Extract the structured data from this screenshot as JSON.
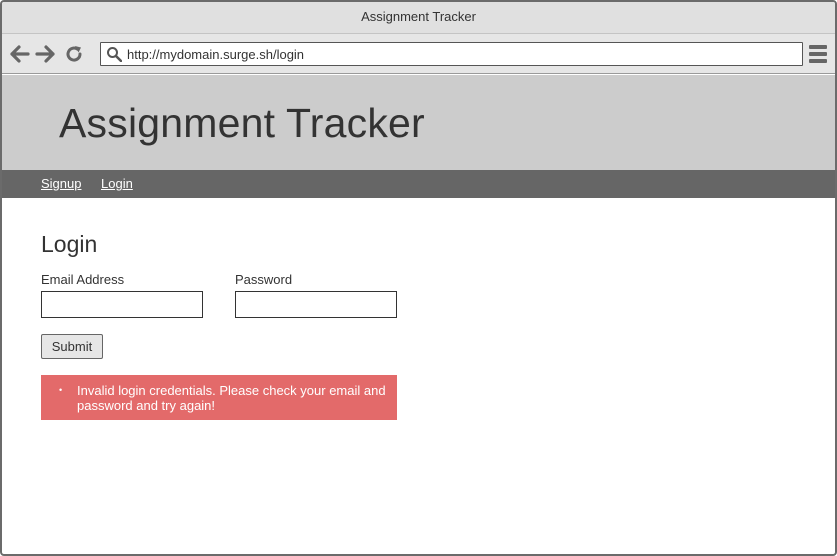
{
  "window": {
    "title": "Assignment Tracker"
  },
  "browser": {
    "url": "http://mydomain.surge.sh/login",
    "icons": {
      "back": "arrow-left-icon",
      "forward": "arrow-right-icon",
      "reload": "reload-icon",
      "search": "search-icon",
      "menu": "hamburger-menu-icon"
    }
  },
  "site": {
    "title": "Assignment Tracker",
    "nav": [
      {
        "label": "Signup"
      },
      {
        "label": "Login"
      }
    ]
  },
  "login_form": {
    "heading": "Login",
    "email_label": "Email Address",
    "email_value": "",
    "password_label": "Password",
    "password_value": "",
    "submit_label": "Submit"
  },
  "errors": [
    {
      "bullet": "•",
      "message": "Invalid login credentials. Please check your email and password and try again!"
    }
  ],
  "colors": {
    "header_bg": "#cccccc",
    "navbar_bg": "#666666",
    "error_bg": "#e36a6a"
  }
}
